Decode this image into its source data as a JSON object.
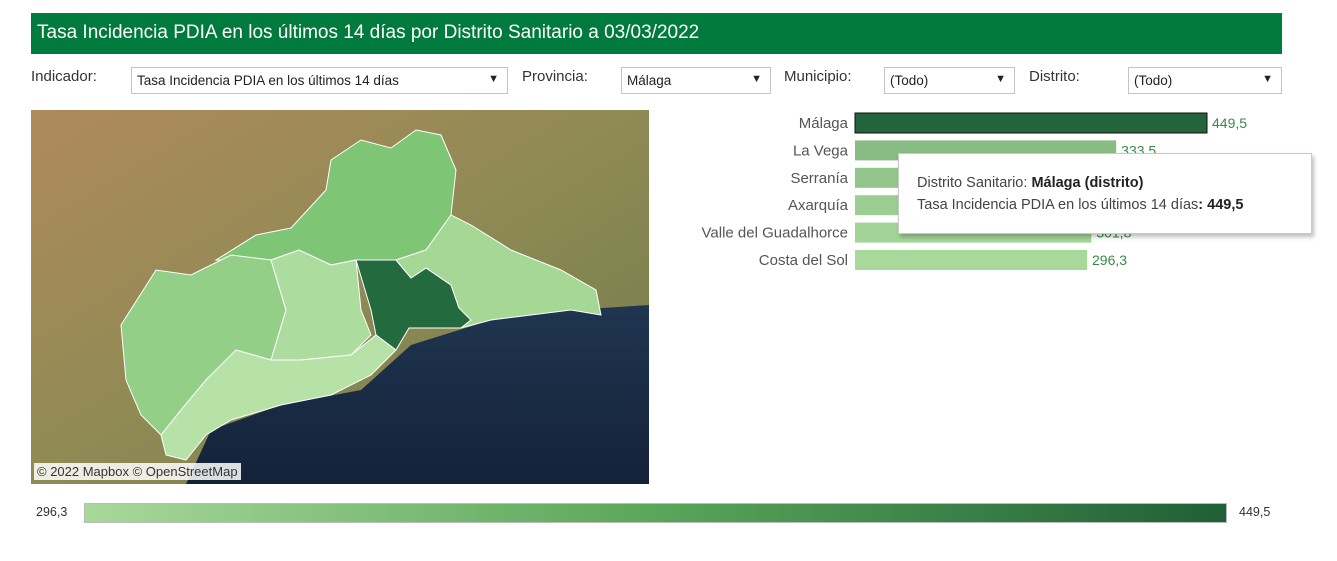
{
  "header": {
    "title": "Tasa Incidencia PDIA en los últimos 14 días por Distrito Sanitario a 03/03/2022"
  },
  "filters": {
    "indicador": {
      "label": "Indicador:",
      "value": "Tasa Incidencia PDIA en los últimos 14 días"
    },
    "provincia": {
      "label": "Provincia:",
      "value": "Málaga"
    },
    "municipio": {
      "label": "Municipio:",
      "value": "(Todo)"
    },
    "distrito": {
      "label": "Distrito:",
      "value": "(Todo)"
    }
  },
  "map": {
    "credit": "© 2022 Mapbox  © OpenStreetMap"
  },
  "tooltip": {
    "field1_label": "Distrito Sanitario: ",
    "field1_value": "Málaga (distrito)",
    "field2_label": "Tasa Incidencia PDIA en los últimos 14 días",
    "field2_value": ": 449,5"
  },
  "legend": {
    "min": "296,3",
    "max": "449,5"
  },
  "colors": {
    "header_bg": "#007a3d",
    "scale_low": "#a8d89a",
    "scale_high": "#1f5f36",
    "value_text": "#3a8a4a"
  },
  "chart_data": {
    "type": "bar",
    "orientation": "horizontal",
    "categories": [
      "Málaga",
      "La Vega",
      "Serranía",
      "Axarquía",
      "Valle del Guadalhorce",
      "Costa del Sol"
    ],
    "values": [
      449.5,
      333.5,
      320.0,
      310.0,
      301.8,
      296.3
    ],
    "value_labels": [
      "449,5",
      "333,5",
      "",
      "",
      "301,8",
      "296,3"
    ],
    "highlighted": "Málaga",
    "xlim": [
      0,
      449.5
    ]
  }
}
